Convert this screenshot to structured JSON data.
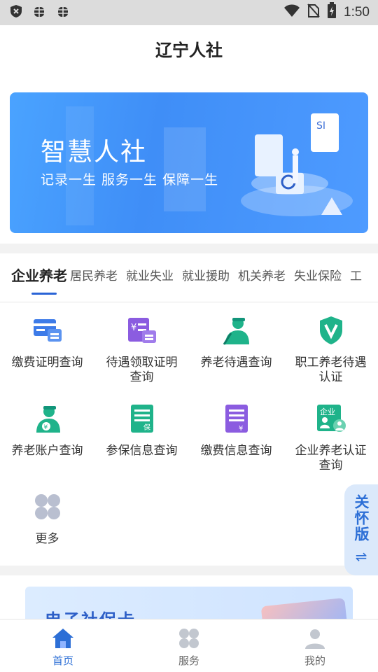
{
  "status": {
    "time": "1:50"
  },
  "header": {
    "title": "辽宁人社"
  },
  "banner": {
    "title": "智慧人社",
    "subtitle": "记录一生  服务一生  保障一生"
  },
  "tabs": [
    {
      "label": "企业养老"
    },
    {
      "label": "居民养老"
    },
    {
      "label": "就业失业"
    },
    {
      "label": "就业援助"
    },
    {
      "label": "机关养老"
    },
    {
      "label": "失业保险"
    },
    {
      "label": "工"
    }
  ],
  "services": [
    {
      "label": "缴费证明查询",
      "icon": "payment-certificate-icon"
    },
    {
      "label": "待遇领取证明查询",
      "icon": "benefit-certificate-icon"
    },
    {
      "label": "养老待遇查询",
      "icon": "pension-benefit-icon"
    },
    {
      "label": "职工养老待遇认证",
      "icon": "verification-shield-icon"
    },
    {
      "label": "养老账户查询",
      "icon": "pension-account-icon"
    },
    {
      "label": "参保信息查询",
      "icon": "insurance-info-icon"
    },
    {
      "label": "缴费信息查询",
      "icon": "payment-info-icon"
    },
    {
      "label": "企业养老认证查询",
      "icon": "enterprise-certification-icon"
    },
    {
      "label": "更多",
      "icon": "more-grid-icon"
    }
  ],
  "care_mode": {
    "label": "关怀版",
    "symbol": "⇌"
  },
  "card_banner": {
    "title": "电子社保卡"
  },
  "navbar": [
    {
      "label": "首页",
      "active": true
    },
    {
      "label": "服务",
      "active": false
    },
    {
      "label": "我的",
      "active": false
    }
  ],
  "colors": {
    "primary": "#2d6fd6",
    "icon_blue": "#3d7be8",
    "icon_purple": "#8b5ce0",
    "icon_green": "#1fb38a"
  }
}
